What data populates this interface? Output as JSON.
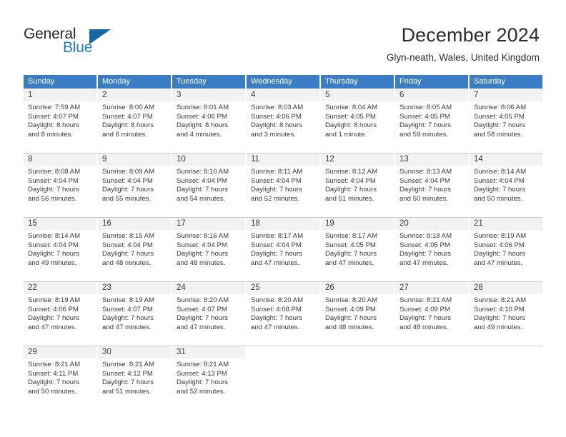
{
  "logo": {
    "word_one": "General",
    "word_two": "Blue",
    "triangle_color": "#1767a8",
    "blue_color": "#1f7cc4"
  },
  "header": {
    "title": "December 2024",
    "subtitle": "Glyn-neath, Wales, United Kingdom",
    "header_bg": "#3b7dc4",
    "daynum_bg": "#f2f2f2"
  },
  "weekdays": [
    "Sunday",
    "Monday",
    "Tuesday",
    "Wednesday",
    "Thursday",
    "Friday",
    "Saturday"
  ],
  "weeks": [
    [
      {
        "day": "1",
        "sunrise": "Sunrise: 7:59 AM",
        "sunset": "Sunset: 4:07 PM",
        "daylight_line1": "Daylight: 8 hours",
        "daylight_line2": "and 8 minutes."
      },
      {
        "day": "2",
        "sunrise": "Sunrise: 8:00 AM",
        "sunset": "Sunset: 4:07 PM",
        "daylight_line1": "Daylight: 8 hours",
        "daylight_line2": "and 6 minutes."
      },
      {
        "day": "3",
        "sunrise": "Sunrise: 8:01 AM",
        "sunset": "Sunset: 4:06 PM",
        "daylight_line1": "Daylight: 8 hours",
        "daylight_line2": "and 4 minutes."
      },
      {
        "day": "4",
        "sunrise": "Sunrise: 8:03 AM",
        "sunset": "Sunset: 4:06 PM",
        "daylight_line1": "Daylight: 8 hours",
        "daylight_line2": "and 3 minutes."
      },
      {
        "day": "5",
        "sunrise": "Sunrise: 8:04 AM",
        "sunset": "Sunset: 4:05 PM",
        "daylight_line1": "Daylight: 8 hours",
        "daylight_line2": "and 1 minute."
      },
      {
        "day": "6",
        "sunrise": "Sunrise: 8:05 AM",
        "sunset": "Sunset: 4:05 PM",
        "daylight_line1": "Daylight: 7 hours",
        "daylight_line2": "and 59 minutes."
      },
      {
        "day": "7",
        "sunrise": "Sunrise: 8:06 AM",
        "sunset": "Sunset: 4:05 PM",
        "daylight_line1": "Daylight: 7 hours",
        "daylight_line2": "and 58 minutes."
      }
    ],
    [
      {
        "day": "8",
        "sunrise": "Sunrise: 8:08 AM",
        "sunset": "Sunset: 4:04 PM",
        "daylight_line1": "Daylight: 7 hours",
        "daylight_line2": "and 56 minutes."
      },
      {
        "day": "9",
        "sunrise": "Sunrise: 8:09 AM",
        "sunset": "Sunset: 4:04 PM",
        "daylight_line1": "Daylight: 7 hours",
        "daylight_line2": "and 55 minutes."
      },
      {
        "day": "10",
        "sunrise": "Sunrise: 8:10 AM",
        "sunset": "Sunset: 4:04 PM",
        "daylight_line1": "Daylight: 7 hours",
        "daylight_line2": "and 54 minutes."
      },
      {
        "day": "11",
        "sunrise": "Sunrise: 8:11 AM",
        "sunset": "Sunset: 4:04 PM",
        "daylight_line1": "Daylight: 7 hours",
        "daylight_line2": "and 52 minutes."
      },
      {
        "day": "12",
        "sunrise": "Sunrise: 8:12 AM",
        "sunset": "Sunset: 4:04 PM",
        "daylight_line1": "Daylight: 7 hours",
        "daylight_line2": "and 51 minutes."
      },
      {
        "day": "13",
        "sunrise": "Sunrise: 8:13 AM",
        "sunset": "Sunset: 4:04 PM",
        "daylight_line1": "Daylight: 7 hours",
        "daylight_line2": "and 50 minutes."
      },
      {
        "day": "14",
        "sunrise": "Sunrise: 8:14 AM",
        "sunset": "Sunset: 4:04 PM",
        "daylight_line1": "Daylight: 7 hours",
        "daylight_line2": "and 50 minutes."
      }
    ],
    [
      {
        "day": "15",
        "sunrise": "Sunrise: 8:14 AM",
        "sunset": "Sunset: 4:04 PM",
        "daylight_line1": "Daylight: 7 hours",
        "daylight_line2": "and 49 minutes."
      },
      {
        "day": "16",
        "sunrise": "Sunrise: 8:15 AM",
        "sunset": "Sunset: 4:04 PM",
        "daylight_line1": "Daylight: 7 hours",
        "daylight_line2": "and 48 minutes."
      },
      {
        "day": "17",
        "sunrise": "Sunrise: 8:16 AM",
        "sunset": "Sunset: 4:04 PM",
        "daylight_line1": "Daylight: 7 hours",
        "daylight_line2": "and 48 minutes."
      },
      {
        "day": "18",
        "sunrise": "Sunrise: 8:17 AM",
        "sunset": "Sunset: 4:04 PM",
        "daylight_line1": "Daylight: 7 hours",
        "daylight_line2": "and 47 minutes."
      },
      {
        "day": "19",
        "sunrise": "Sunrise: 8:17 AM",
        "sunset": "Sunset: 4:05 PM",
        "daylight_line1": "Daylight: 7 hours",
        "daylight_line2": "and 47 minutes."
      },
      {
        "day": "20",
        "sunrise": "Sunrise: 8:18 AM",
        "sunset": "Sunset: 4:05 PM",
        "daylight_line1": "Daylight: 7 hours",
        "daylight_line2": "and 47 minutes."
      },
      {
        "day": "21",
        "sunrise": "Sunrise: 8:19 AM",
        "sunset": "Sunset: 4:06 PM",
        "daylight_line1": "Daylight: 7 hours",
        "daylight_line2": "and 47 minutes."
      }
    ],
    [
      {
        "day": "22",
        "sunrise": "Sunrise: 8:19 AM",
        "sunset": "Sunset: 4:06 PM",
        "daylight_line1": "Daylight: 7 hours",
        "daylight_line2": "and 47 minutes."
      },
      {
        "day": "23",
        "sunrise": "Sunrise: 8:19 AM",
        "sunset": "Sunset: 4:07 PM",
        "daylight_line1": "Daylight: 7 hours",
        "daylight_line2": "and 47 minutes."
      },
      {
        "day": "24",
        "sunrise": "Sunrise: 8:20 AM",
        "sunset": "Sunset: 4:07 PM",
        "daylight_line1": "Daylight: 7 hours",
        "daylight_line2": "and 47 minutes."
      },
      {
        "day": "25",
        "sunrise": "Sunrise: 8:20 AM",
        "sunset": "Sunset: 4:08 PM",
        "daylight_line1": "Daylight: 7 hours",
        "daylight_line2": "and 47 minutes."
      },
      {
        "day": "26",
        "sunrise": "Sunrise: 8:20 AM",
        "sunset": "Sunset: 4:09 PM",
        "daylight_line1": "Daylight: 7 hours",
        "daylight_line2": "and 48 minutes."
      },
      {
        "day": "27",
        "sunrise": "Sunrise: 8:21 AM",
        "sunset": "Sunset: 4:09 PM",
        "daylight_line1": "Daylight: 7 hours",
        "daylight_line2": "and 48 minutes."
      },
      {
        "day": "28",
        "sunrise": "Sunrise: 8:21 AM",
        "sunset": "Sunset: 4:10 PM",
        "daylight_line1": "Daylight: 7 hours",
        "daylight_line2": "and 49 minutes."
      }
    ],
    [
      {
        "day": "29",
        "sunrise": "Sunrise: 8:21 AM",
        "sunset": "Sunset: 4:11 PM",
        "daylight_line1": "Daylight: 7 hours",
        "daylight_line2": "and 50 minutes."
      },
      {
        "day": "30",
        "sunrise": "Sunrise: 8:21 AM",
        "sunset": "Sunset: 4:12 PM",
        "daylight_line1": "Daylight: 7 hours",
        "daylight_line2": "and 51 minutes."
      },
      {
        "day": "31",
        "sunrise": "Sunrise: 8:21 AM",
        "sunset": "Sunset: 4:13 PM",
        "daylight_line1": "Daylight: 7 hours",
        "daylight_line2": "and 52 minutes."
      },
      {
        "day": "",
        "sunrise": "",
        "sunset": "",
        "daylight_line1": "",
        "daylight_line2": ""
      },
      {
        "day": "",
        "sunrise": "",
        "sunset": "",
        "daylight_line1": "",
        "daylight_line2": ""
      },
      {
        "day": "",
        "sunrise": "",
        "sunset": "",
        "daylight_line1": "",
        "daylight_line2": ""
      },
      {
        "day": "",
        "sunrise": "",
        "sunset": "",
        "daylight_line1": "",
        "daylight_line2": ""
      }
    ]
  ]
}
